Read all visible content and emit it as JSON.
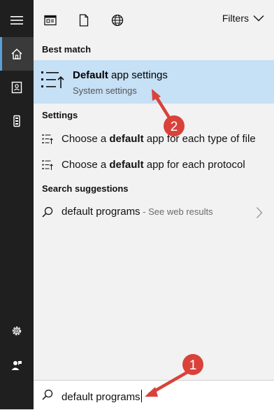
{
  "rail": {
    "items": [
      {
        "icon": "hamburger-menu-icon"
      },
      {
        "icon": "home-icon",
        "active": true
      },
      {
        "icon": "notebook-icon"
      },
      {
        "icon": "device-icon"
      },
      {
        "icon": "settings-gear-icon"
      },
      {
        "icon": "feedback-person-icon"
      }
    ]
  },
  "topbar": {
    "icons": [
      "apps-icon",
      "document-icon",
      "web-globe-icon"
    ],
    "filters_label": "Filters"
  },
  "best_match": {
    "section_label": "Best match",
    "title_bold": "Default",
    "title_rest": " app settings",
    "subtitle": "System settings"
  },
  "settings": {
    "section_label": "Settings",
    "items": [
      {
        "pre": "Choose a ",
        "bold": "default",
        "post": " app for each type of file"
      },
      {
        "pre": "Choose a ",
        "bold": "default",
        "post": " app for each protocol"
      }
    ]
  },
  "suggestions": {
    "section_label": "Search suggestions",
    "items": [
      {
        "query": "default programs",
        "sub": " - See web results"
      }
    ]
  },
  "search": {
    "value": "default programs"
  },
  "annotations": {
    "marker1": "1",
    "marker2": "2",
    "color": "#d9423a"
  },
  "colors": {
    "rail_bg": "#1f1f1f",
    "highlight": "#c6e0f5",
    "active_accent": "#5aa0d8"
  }
}
